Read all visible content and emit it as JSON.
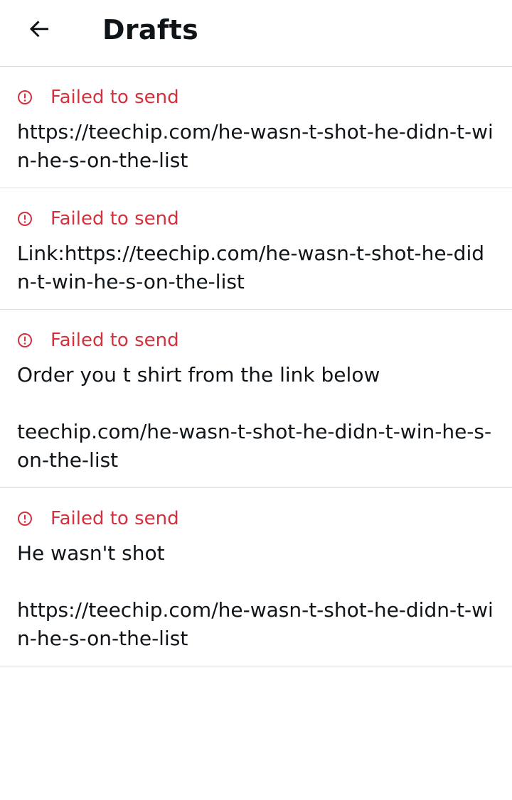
{
  "header": {
    "title": "Drafts",
    "back_icon": "arrow-left-icon"
  },
  "colors": {
    "error": "#d5303d",
    "text": "#0f1419",
    "divider": "#dcdfe2"
  },
  "drafts": [
    {
      "status": "Failed to send",
      "status_icon": "alert-circle-icon",
      "text": "https://teechip.com/he-wasn-t-shot-he-didn-t-win-he-s-on-the-list"
    },
    {
      "status": "Failed to send",
      "status_icon": "alert-circle-icon",
      "text": "Link:https://teechip.com/he-wasn-t-shot-he-didn-t-win-he-s-on-the-list"
    },
    {
      "status": "Failed to send",
      "status_icon": "alert-circle-icon",
      "text": "Order you t shirt from the link below\n\nteechip.com/he-wasn-t-shot-he-didn-t-win-he-s-on-the-list"
    },
    {
      "status": "Failed to send",
      "status_icon": "alert-circle-icon",
      "text": "He wasn't shot\n\nhttps://teechip.com/he-wasn-t-shot-he-didn-t-win-he-s-on-the-list"
    }
  ]
}
